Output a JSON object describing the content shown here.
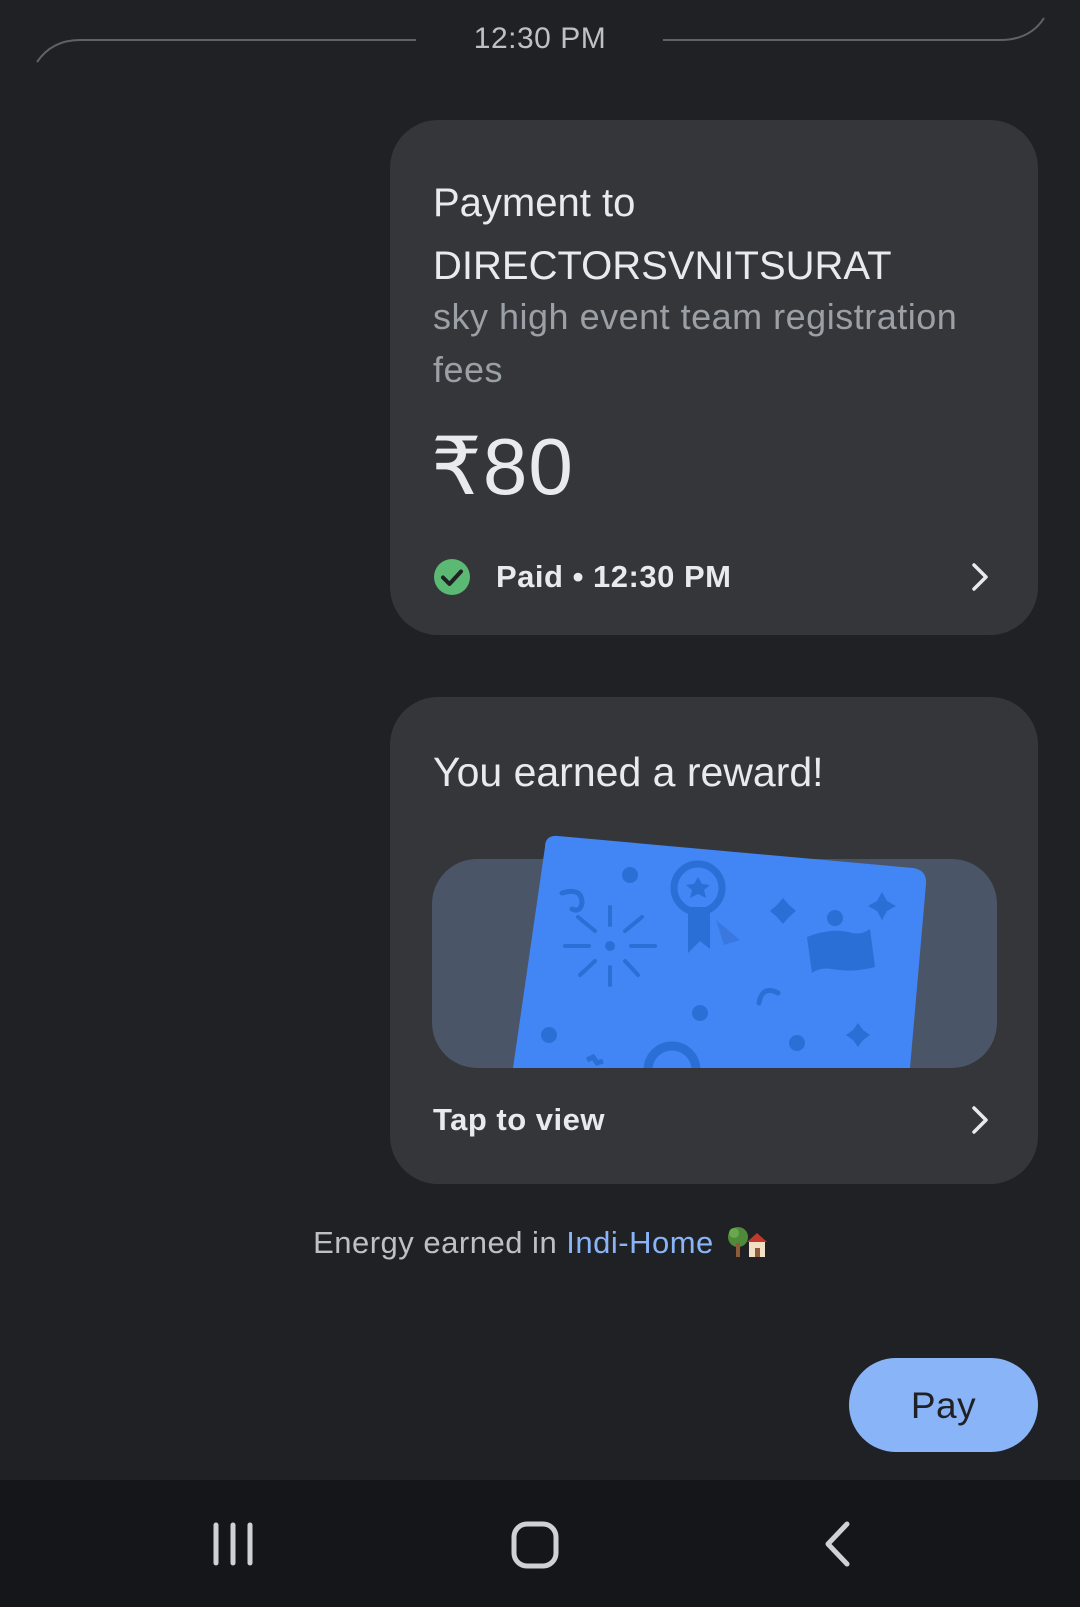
{
  "header": {
    "timestamp": "12:30 PM"
  },
  "payment_card": {
    "title": "Payment to DIRECTORSVNITSURAT",
    "note": "sky high event team registration fees",
    "amount": "₹80",
    "status": "Paid • 12:30 PM",
    "status_icon": "check-circle-icon",
    "status_color": "#5bb974"
  },
  "reward_card": {
    "title": "You earned a reward!",
    "action_label": "Tap to view",
    "art_color": "#4285f4"
  },
  "energy": {
    "prefix": "Energy earned in ",
    "link": "Indi-Home",
    "icon": "tree-house-icon"
  },
  "pay_button": {
    "label": "Pay"
  },
  "nav": {
    "recents_icon": "recents-icon",
    "home_icon": "home-icon",
    "back_icon": "back-icon"
  },
  "colors": {
    "background": "#202124",
    "card": "#35363a",
    "accent": "#8ab4f8"
  }
}
